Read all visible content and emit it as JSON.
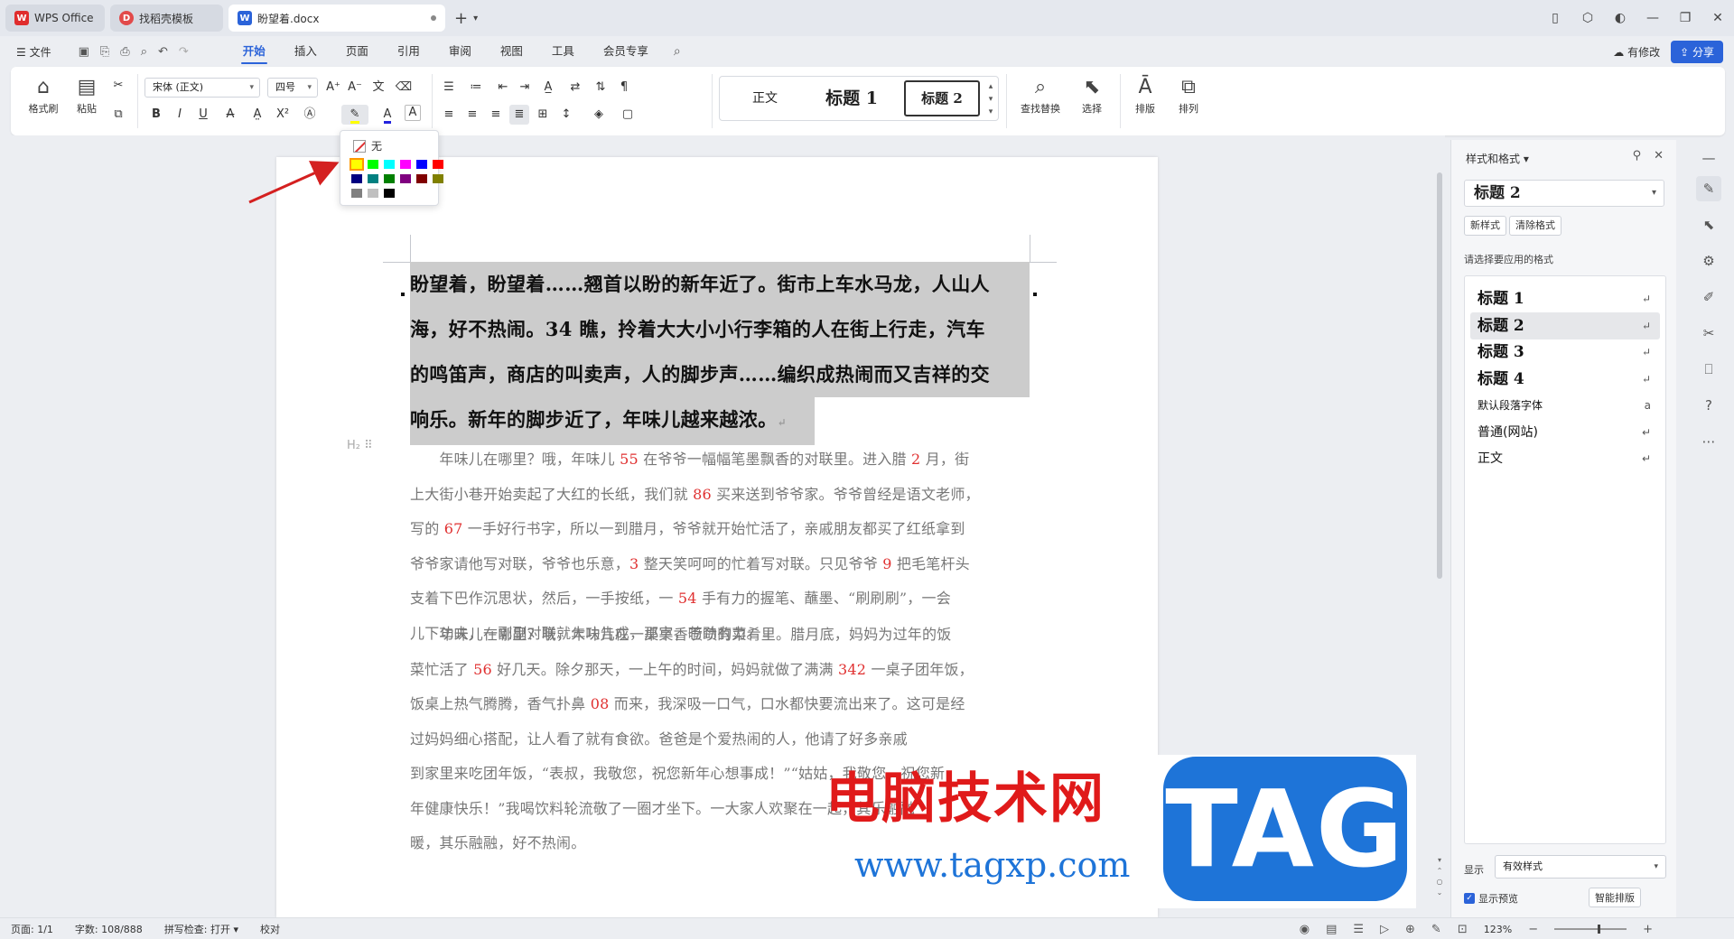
{
  "tabs": [
    {
      "label": "WPS Office",
      "logo": "W"
    },
    {
      "label": "找稻壳模板",
      "logo": "D"
    },
    {
      "label": "盼望着.docx",
      "logo": "W"
    }
  ],
  "menu": {
    "file": "文件",
    "tabs": [
      "开始",
      "插入",
      "页面",
      "引用",
      "审阅",
      "视图",
      "工具",
      "会员专享"
    ],
    "active_tab": "开始",
    "modified": "有修改",
    "share": "分享"
  },
  "ribbon": {
    "format_painter": "格式刷",
    "paste": "粘贴",
    "font_name": "宋体 (正文)",
    "font_size": "四号",
    "styles": [
      "正文",
      "标题 1",
      "标题 2"
    ],
    "find_replace": "查找替换",
    "select": "选择",
    "typeset": "排版",
    "arrange": "排列"
  },
  "highlight_popup": {
    "none_label": "无",
    "colors": [
      "#ffff00",
      "#00ff00",
      "#00ffff",
      "#ff00ff",
      "#0000ff",
      "#ff0000",
      "#000080",
      "#008080",
      "#008000",
      "#800080",
      "#800000",
      "#808000",
      "#808080",
      "#c0c0c0",
      "#000000"
    ],
    "selected_index": 0
  },
  "document": {
    "heading_lines": [
      "盼望着，盼望着……翘首以盼的新年近了。街市上车水马龙，人山人",
      "海，好不热闹。34 瞧，拎着大大小小行李箱的人在街上行走，汽车",
      "的鸣笛声，商店的叫卖声，人的脚步声……编织成热闹而又吉祥的交",
      "响乐。新年的脚步近了，年味儿越来越浓。"
    ],
    "h2_marker": "H₂",
    "para1": [
      [
        "　　年味儿在哪里？哦，年味儿 ",
        "55",
        " 在爷爷一幅幅笔墨飘香的对联里。进入腊 ",
        "2",
        " 月，街"
      ],
      [
        "上大街小巷开始卖起了大红的长纸，我们就 ",
        "86",
        " 买来送到爷爷家。爷爷曾经是语文老师，"
      ],
      [
        "写的 ",
        "67",
        " 一手好行书字，所以一到腊月，爷爷就开始忙活了，亲戚朋友都买了红纸拿到"
      ],
      [
        "爷爷家请他写对联，爷爷也乐意，",
        "3",
        " 整天笑呵呵的忙着写对联。只见爷爷 ",
        "9",
        " 把毛笔杆头"
      ],
      [
        "支着下巴作沉思状，然后，一手按纸，一 ",
        "54",
        " 手有力的握笔、蘸墨、“刷刷刷”，一会"
      ],
      [
        "儿下功夫，一副副对联就大功告成，那字，苍劲有力。"
      ]
    ],
    "para2": [
      [
        "　　年味儿在哪里？哦，年味儿在一桌桌香喷喷的菜肴里。腊月底，妈妈为过年的饭"
      ],
      [
        "菜忙活了 ",
        "56",
        " 好几天。除夕那天，一上午的时间，妈妈就做了满满 ",
        "342",
        " 一桌子团年饭，"
      ],
      [
        "饭桌上热气腾腾，香气扑鼻 ",
        "08",
        " 而来，我深吸一口气，口水都快要流出来了。这可是经"
      ],
      [
        "过妈妈细心搭配，让人看了就有食欲。爸爸是个爱热闹的人，他请了好多亲戚"
      ],
      [
        "到家里来吃团年饭，“表叔，我敬您，祝您新年心想事成！”“姑姑，我敬您，祝您新"
      ],
      [
        "年健康快乐！”我喝饮料轮流敬了一圈才坐下。一大家人欢聚在一起，其乐融融"
      ],
      [
        "暖，其乐融融，好不热闹。"
      ]
    ]
  },
  "watermark": {
    "site_name": "电脑技术网",
    "url": "www.tagxp.com",
    "tag": "TAG"
  },
  "panel": {
    "title": "样式和格式",
    "current_style": "标题 2",
    "new_style": "新样式",
    "clear_format": "清除格式",
    "hint": "请选择要应用的格式",
    "styles": [
      {
        "label": "标题 1",
        "kind": "h"
      },
      {
        "label": "标题 2",
        "kind": "h",
        "selected": true
      },
      {
        "label": "标题 3",
        "kind": "h"
      },
      {
        "label": "标题 4",
        "kind": "h"
      },
      {
        "label": "默认段落字体",
        "kind": "small"
      },
      {
        "label": "普通(网站)",
        "kind": "normal"
      },
      {
        "label": "正文",
        "kind": "normal"
      }
    ],
    "show_label": "显示",
    "show_value": "有效样式",
    "preview_label": "显示预览",
    "smart_typeset": "智能排版"
  },
  "statusbar": {
    "page": "页面: 1/1",
    "words": "字数: 108/888",
    "spellcheck": "拼写检查: 打开",
    "proof": "校对",
    "zoom": "123%"
  },
  "accent_color": "#2b63d9"
}
